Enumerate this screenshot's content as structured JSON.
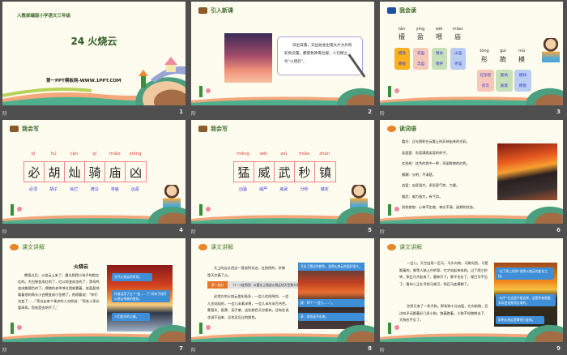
{
  "footer_left": "阶",
  "slides": [
    {
      "num": "1",
      "subtitle": "人教部编版小学语文三年级",
      "title": "24  火烧云",
      "site": "第一PPT模板网-WWW.1PPT.COM"
    },
    {
      "num": "2",
      "header": "引入新课",
      "text": "日出日落，天边总会出现大片大片的彩色云霞，那景色神奇壮观，人们称之为“火烧云”。"
    },
    {
      "num": "3",
      "header": "我会读",
      "chars1": [
        {
          "py": "tán",
          "c": "檀",
          "w": [
            "檀香",
            "檀板"
          ],
          "color": "#f7b21e"
        },
        {
          "py": "yíng",
          "c": "盈",
          "w": [
            "充盈",
            "丰盈"
          ],
          "color": "#f6c8b8"
        },
        {
          "py": "wèi",
          "c": "喂",
          "w": [
            "喂食",
            "喂养"
          ],
          "color": "#c8e0b8"
        },
        {
          "py": "miào",
          "c": "庙",
          "w": [
            "山庙",
            "寺庙"
          ],
          "color": "#b8cdf0"
        }
      ],
      "chars2": [
        {
          "py": "tóng",
          "c": "彤",
          "w": [
            "红彤彤",
            "彤云"
          ],
          "color": "#f6c8b8"
        },
        {
          "py": "guì",
          "c": "跪",
          "w": [
            "跪地",
            "跪着"
          ],
          "color": "#c8e0b8"
        },
        {
          "py": "mú",
          "c": "模",
          "w": [
            "模样",
            "模板"
          ],
          "color": "#b8cdf0"
        }
      ]
    },
    {
      "num": "4",
      "header": "我会写",
      "py": [
        "bì",
        "hú",
        "càn",
        "qí",
        "miào",
        "xiōng"
      ],
      "chars": [
        "必",
        "胡",
        "灿",
        "骑",
        "庙",
        "凶"
      ],
      "words": [
        "必须",
        "胡子",
        "灿烂",
        "骑马",
        "寺庙",
        "凶恶"
      ]
    },
    {
      "num": "5",
      "header": "我会写",
      "py": [
        "měng",
        "wēi",
        "wǔ",
        "miǎo",
        "zhèn"
      ],
      "chars": [
        "猛",
        "威",
        "武",
        "秒",
        "镇"
      ],
      "words": [
        "凶猛",
        "威严",
        "威武",
        "分秒",
        "镇定"
      ]
    },
    {
      "num": "6",
      "header": "读词语",
      "lines": [
        "霞光：日光照射在云雾上所反映出来的光彩。",
        "笑盈盈：形容满面笑容的样子。",
        "红彤彤：红色的其中一种，亮丽鲜艳的红色。",
        "模糊：分明；不清楚。",
        "凶猛：凶恶强大。多形容气势、力量。",
        "威武：威力强大，有气势。",
        "恍恍惚惚：心神不定貌，神志不清、迷惘的状态。"
      ]
    },
    {
      "num": "7",
      "header": "课文讲解",
      "title": "火烧云",
      "text": "晚饭过后，火烧云上来了。霞光照得小孩子的脸红红的。大白狗变成红的了，红公鸡变成金的了，黑母鸡变成紫檀色的了。喂猪的老爷爷在墙根靠着，笑盈盈地看着他的两头小白猪变成小金猪了。他刚要说：“你们也变了……”旁边走来个乘凉的人对他说：“您老人家必要高寿，您老是金胡子了。”",
      "callouts": [
        "交代火烧云的时间。",
        "作者运用了五个“变……了”的句子描写火烧云带来的变化。",
        "人们欢乐的心情。"
      ]
    },
    {
      "num": "8",
      "header": "课文讲解",
      "text1": "天上的云从西边一直烧到东边，红彤彤的，好像是天空着了火。",
      "part_label": "第一部分",
      "part_text": "（1－2自然段）从霞光上描述火烧云给天空和大地万物带来的变化。",
      "text2": "这地方的火烧云变化极多，一会儿红彤彤的，一会儿金灿灿的，一会儿半紫半黄，一会儿半灰半百合色。葡萄灰、梨黄、茄子紫，这些颜色天空都有。还有些说也说不出来、见也没见过的颜色。",
      "callouts": [
        "写出了霞光的颜色，说明火烧云的面积很大。",
        "颜：四个“一会儿……”。",
        "多：说也说不出来。"
      ]
    },
    {
      "num": "9",
      "header": "课文讲解",
      "text1": "一会儿，天空出现一匹马，马头向南，马尾向西。马是跪着的，像等人骑上它的背，它才站起来似的。过了两三秒钟，那匹马大起来了，腿伸开了，脖子也长了，尾巴可不见了。看的人正在寻找马尾巴，那匹马变模糊了。",
      "text2": "忽然又来了一条大狗。那条狗十分凶猛，在向前跑，后边似乎还跟着好几条小狗。跑着跑着，小狗不知跑哪去了，大狗也不见了。",
      "callouts": [
        "“过了两三秒钟”说明火烧云的变化之快。",
        "“似乎”在这里不能去掉，这是作者根据实际变化推测出来的。",
        "说明火烧云是瞬息万变的。"
      ]
    }
  ]
}
